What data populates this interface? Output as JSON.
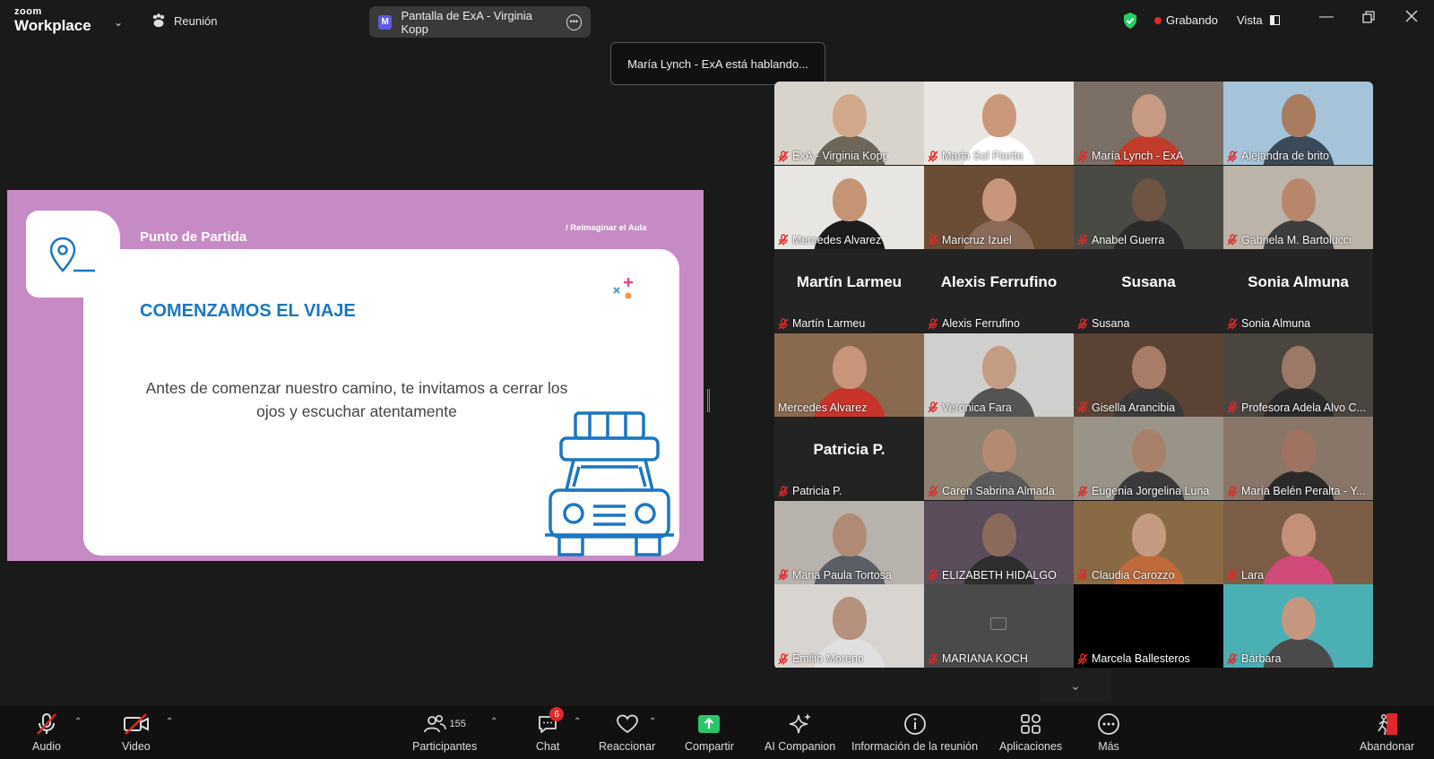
{
  "app": {
    "logo_top": "zoom",
    "logo_bottom": "Workplace",
    "meeting_label": "Reunión"
  },
  "share": {
    "badge": "M",
    "title": "Pantalla de ExA - Virginia Kopp"
  },
  "status": {
    "recording": "Grabando",
    "view": "Vista"
  },
  "speaking_banner": "María Lynch - ExA está hablando...",
  "slide": {
    "section": "Punto de Partida",
    "tag": "/ Reimaginar el Aula",
    "heading": "COMENZAMOS EL VIAJE",
    "body_line1": "Antes de comenzar nuestro camino, te invitamos a cerrar los",
    "body_line2": "ojos y escuchar atentamente"
  },
  "participants": [
    {
      "name": "ExA - Virginia Kopp",
      "video": true,
      "bg": "#d8d4cc",
      "skin": "#d2a88a",
      "cloth": "#6d6659"
    },
    {
      "name": "Maria Sol Fiorito",
      "video": true,
      "bg": "#e9e6e1",
      "skin": "#c9987a",
      "cloth": "#ffffff"
    },
    {
      "name": "María Lynch - ExA",
      "video": true,
      "active": true,
      "bg": "#7b6f66",
      "skin": "#c69a83",
      "cloth": "#c23c2c"
    },
    {
      "name": "Alejandra de brito",
      "video": true,
      "bg": "#a6c4d9",
      "skin": "#a97b5f",
      "cloth": "#3a4a5a"
    },
    {
      "name": "Mercedes Alvarez",
      "video": true,
      "bg": "#e8e6e3",
      "skin": "#c59475",
      "cloth": "#1c1c1c"
    },
    {
      "name": "Maricruz Izuel",
      "video": true,
      "bg": "#6b4c35",
      "skin": "#c8967a",
      "cloth": "#8a6a58"
    },
    {
      "name": "Anabel Guerra",
      "video": true,
      "bg": "#4a4a44",
      "skin": "#6e5443",
      "cloth": "#2b2b2b"
    },
    {
      "name": "Gabriela M. Bartolucci",
      "video": true,
      "bg": "#bcb4a8",
      "skin": "#b8876b",
      "cloth": "#3d3d3d"
    },
    {
      "name": "Martín Larmeu",
      "video": false
    },
    {
      "name": "Alexis Ferrufino",
      "video": false
    },
    {
      "name": "Susana",
      "video": false
    },
    {
      "name": "Sonia Almuna",
      "video": false
    },
    {
      "name": "Mercedes Alvarez",
      "video": true,
      "bg": "#8a6a4f",
      "skin": "#c8957a",
      "cloth": "#c8342a",
      "nomic": true
    },
    {
      "name": "Verónica Fara",
      "video": true,
      "bg": "#cfd0cd",
      "skin": "#c49c84",
      "cloth": "#545454"
    },
    {
      "name": "Gisella Arancibia",
      "video": true,
      "bg": "#5a4234",
      "skin": "#a87c66",
      "cloth": "#3a3a3a"
    },
    {
      "name": "Profesora Adela Alvo C...",
      "video": true,
      "bg": "#4b4540",
      "skin": "#9c7866",
      "cloth": "#2b2b2b"
    },
    {
      "name": "Patricia P.",
      "video": false
    },
    {
      "name": "Caren Sabrina Almada",
      "video": true,
      "bg": "#8f8270",
      "skin": "#b48a72",
      "cloth": "#5a5a5a"
    },
    {
      "name": "Eugenia Jorgelina Luna",
      "video": true,
      "bg": "#9a9488",
      "skin": "#a88069",
      "cloth": "#3a3a3a"
    },
    {
      "name": "María Belén Peralta - Y...",
      "video": true,
      "bg": "#8a7668",
      "skin": "#a07262",
      "cloth": "#2a2a2a"
    },
    {
      "name": "Maria Paula Tortosa",
      "video": true,
      "bg": "#b7b2ab",
      "skin": "#b08a74",
      "cloth": "#5a5e66"
    },
    {
      "name": "ELIZABETH HIDALGO",
      "video": true,
      "bg": "#5a4c5a",
      "skin": "#8a6a5a",
      "cloth": "#2e2e2e"
    },
    {
      "name": "Claudia Carozzo",
      "video": true,
      "bg": "#8a6a44",
      "skin": "#c59a80",
      "cloth": "#c06a3a"
    },
    {
      "name": "Lara",
      "video": true,
      "bg": "#7b5e45",
      "skin": "#c49077",
      "cloth": "#d04a7a"
    },
    {
      "name": "Emilio Moreno",
      "video": true,
      "bg": "#d8d4cf",
      "skin": "#b5917e",
      "cloth": "#e0e0e0"
    },
    {
      "name": "MARIANA KOCH",
      "video": false,
      "placeholder": true
    },
    {
      "name": "Marcela Ballesteros",
      "video": false,
      "black": true
    },
    {
      "name": "Bárbara",
      "video": true,
      "bg": "#4ab0b4",
      "skin": "#c4977e",
      "cloth": "#4a4a4a"
    }
  ],
  "toolbar": {
    "audio": "Audio",
    "video": "Video",
    "participants": "Participantes",
    "participants_count": "155",
    "chat": "Chat",
    "chat_badge": "6",
    "react": "Reaccionar",
    "share": "Compartir",
    "ai": "AI Companion",
    "info": "Información de la reunión",
    "apps": "Aplicaciones",
    "more": "Más",
    "leave": "Abandonar"
  },
  "colors": {
    "accent_green": "#23d160",
    "record_red": "#e02828",
    "share_green": "#2cc46a",
    "slide_pink": "#c68bc4",
    "slide_blue": "#1b77c4"
  }
}
